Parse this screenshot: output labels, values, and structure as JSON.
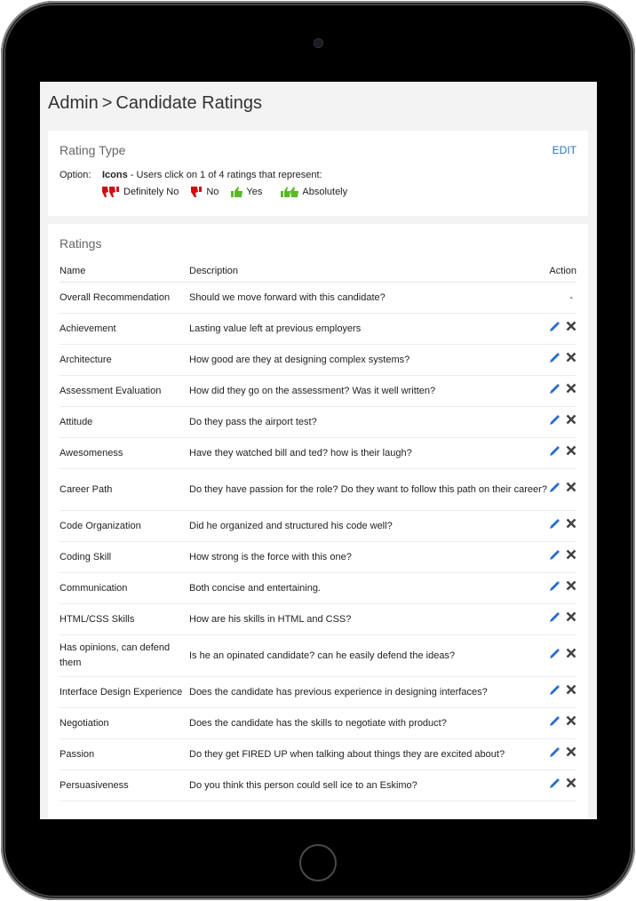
{
  "breadcrumb": {
    "parent": "Admin",
    "separator": ">",
    "current": "Candidate Ratings"
  },
  "rating_type": {
    "title": "Rating Type",
    "edit_label": "EDIT",
    "option_label": "Option:",
    "option_name": "Icons",
    "option_desc": " - Users click on 1 of 4 ratings that represent:",
    "ratings": [
      {
        "icon": "double-thumbs-down-icon",
        "label": "Definitely No",
        "color": "#cc1111"
      },
      {
        "icon": "thumbs-down-icon",
        "label": "No",
        "color": "#cc1111"
      },
      {
        "icon": "thumbs-up-icon",
        "label": "Yes",
        "color": "#5cb82a"
      },
      {
        "icon": "double-thumbs-up-icon",
        "label": "Absolutely",
        "color": "#5cb82a"
      }
    ]
  },
  "ratings": {
    "title": "Ratings",
    "columns": {
      "name": "Name",
      "description": "Description",
      "action": "Action"
    },
    "rows": [
      {
        "name": "Overall Recommendation",
        "description": "Should we move forward with this candidate?",
        "action": "-"
      },
      {
        "name": "Achievement",
        "description": "Lasting value left at previous employers"
      },
      {
        "name": "Architecture",
        "description": "How good are they at designing complex systems?"
      },
      {
        "name": "Assessment Evaluation",
        "description": "How did they go on the assessment? Was it well written?"
      },
      {
        "name": "Attitude",
        "description": "Do they pass the airport test?"
      },
      {
        "name": "Awesomeness",
        "description": "Have they watched bill and ted? how is their laugh?"
      },
      {
        "name": "Career Path",
        "description": "Do they have passion for the role? Do they want to follow this path on their career?",
        "tall": true
      },
      {
        "name": "Code Organization",
        "description": "Did he organized and structured his code well?"
      },
      {
        "name": "Coding Skill",
        "description": "How strong is the force with this one?"
      },
      {
        "name": "Communication",
        "description": "Both concise and entertaining."
      },
      {
        "name": "HTML/CSS Skills",
        "description": "How are his skills in HTML and CSS?"
      },
      {
        "name": "Has opinions, can defend them",
        "description": "Is he an opinated candidate? can he easily defend the ideas?",
        "tall": true
      },
      {
        "name": "Interface Design Experience",
        "description": "Does the candidate has previous experience in designing interfaces?"
      },
      {
        "name": "Negotiation",
        "description": "Does the candidate has the skills to negotiate with product?"
      },
      {
        "name": "Passion",
        "description": "Do they get FIRED UP when talking about things they are excited about?"
      },
      {
        "name": "Persuasiveness",
        "description": "Do you think this person could sell ice to an Eskimo?"
      }
    ]
  },
  "colors": {
    "link": "#2f6fb7",
    "edit_icon": "#2a6cc8",
    "delete_icon": "#444444"
  }
}
